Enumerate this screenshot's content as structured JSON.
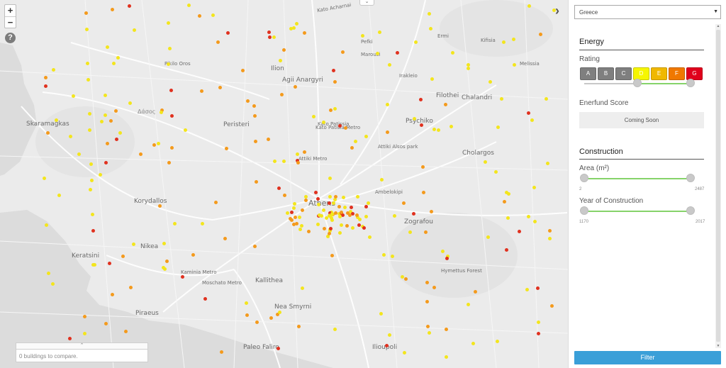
{
  "map": {
    "labels": [
      {
        "text": "Kato Acharnai",
        "cls": ""
      },
      {
        "text": "Kifisia",
        "cls": ""
      },
      {
        "text": "Ilion",
        "cls": "l2"
      },
      {
        "text": "Agii Anargyri",
        "cls": "l2"
      },
      {
        "text": "Kato Patissia",
        "cls": ""
      },
      {
        "text": "Filothei",
        "cls": "l2"
      },
      {
        "text": "Chalandri",
        "cls": "l2"
      },
      {
        "text": "Δάσος",
        "cls": "sea"
      },
      {
        "text": "Skaramagkas",
        "cls": "l2"
      },
      {
        "text": "Peristeri",
        "cls": "l2"
      },
      {
        "text": "Psychiko",
        "cls": "l2"
      },
      {
        "text": "Cholargos",
        "cls": "l2"
      },
      {
        "text": "Korydallos",
        "cls": "l2"
      },
      {
        "text": "Athens",
        "cls": "big"
      },
      {
        "text": "Ambelokipi",
        "cls": ""
      },
      {
        "text": "Zografou",
        "cls": "l2"
      },
      {
        "text": "Nikea",
        "cls": "l2"
      },
      {
        "text": "Keratsini",
        "cls": "l2"
      },
      {
        "text": "Kallithea",
        "cls": "l2"
      },
      {
        "text": "Piraeus",
        "cls": "l2"
      },
      {
        "text": "Nea Smyrni",
        "cls": "l2"
      },
      {
        "text": "Paleo Faliro",
        "cls": "l2"
      },
      {
        "text": "Ilioupoli",
        "cls": "l2"
      },
      {
        "text": "Pikilo Oros",
        "cls": ""
      },
      {
        "text": "Pefki",
        "cls": ""
      },
      {
        "text": "Marousi",
        "cls": ""
      },
      {
        "text": "Irakleio",
        "cls": ""
      },
      {
        "text": "Ermi",
        "cls": ""
      },
      {
        "text": "Melissia",
        "cls": ""
      },
      {
        "text": "Attiki Metro",
        "cls": ""
      },
      {
        "text": "Kato Patisia Metro",
        "cls": ""
      },
      {
        "text": "Attiki Alsos park",
        "cls": ""
      },
      {
        "text": "Hymettus Forest",
        "cls": ""
      },
      {
        "text": "Moschato Metro",
        "cls": ""
      },
      {
        "text": "Kaminia Metro",
        "cls": ""
      }
    ]
  },
  "controls": {
    "zoom_in": "+",
    "zoom_out": "−",
    "help": "?",
    "collapse_glyph": "›",
    "top_toggle_glyph": "⌄"
  },
  "compare": {
    "tab_glyph": "⌃",
    "text": "0 buildings to compare."
  },
  "panel": {
    "country": "Greece",
    "energy": {
      "title": "Energy",
      "rating_label": "Rating",
      "ratings": [
        {
          "label": "A",
          "color": "#7f7f7f"
        },
        {
          "label": "B",
          "color": "#7f7f7f"
        },
        {
          "label": "C",
          "color": "#7f7f7f"
        },
        {
          "label": "D",
          "color": "#f6f600"
        },
        {
          "label": "E",
          "color": "#f0b800"
        },
        {
          "label": "F",
          "color": "#f07800"
        },
        {
          "label": "G",
          "color": "#e0001c"
        }
      ],
      "rating_range_selected": [
        "D",
        "G"
      ],
      "score_label": "Enerfund Score",
      "score_value": "Coming Soon"
    },
    "construction": {
      "title": "Construction",
      "area_label": "Area (m²)",
      "area_min": "2",
      "area_max": "2487",
      "year_label": "Year of Construction",
      "year_min": "1170",
      "year_max": "2017"
    },
    "filter_label": "Filter"
  },
  "colors": {
    "accent": "#3a9fd8",
    "slider_fill": "#86d36a",
    "dot_yellow": "#f3e51d",
    "dot_orange": "#f49a1c",
    "dot_red": "#e0311f"
  }
}
